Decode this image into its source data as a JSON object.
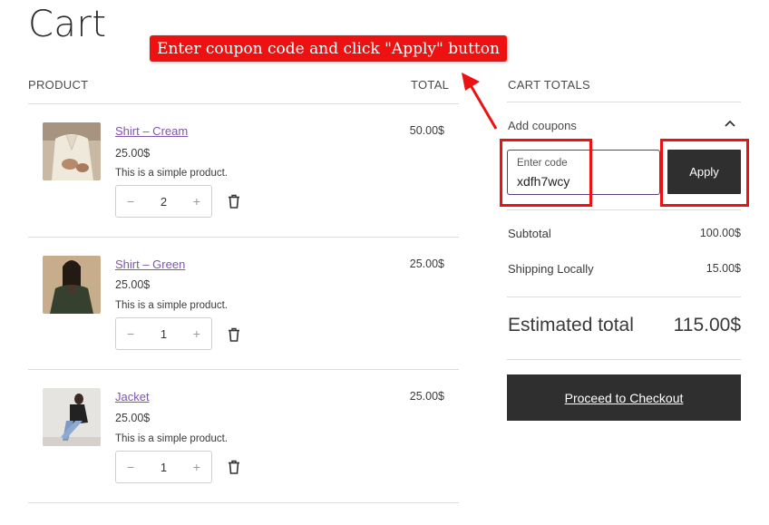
{
  "page": {
    "title": "Cart"
  },
  "callout": {
    "text": "Enter coupon code and click \"Apply\" button"
  },
  "table": {
    "product_header": "PRODUCT",
    "total_header": "TOTAL"
  },
  "items": [
    {
      "name": "Shirt – Cream",
      "price": "25.00$",
      "description": "This is a simple product.",
      "quantity": "2",
      "total": "50.00$"
    },
    {
      "name": "Shirt – Green",
      "price": "25.00$",
      "description": "This is a simple product.",
      "quantity": "1",
      "total": "25.00$"
    },
    {
      "name": "Jacket",
      "price": "25.00$",
      "description": "This is a simple product.",
      "quantity": "1",
      "total": "25.00$"
    }
  ],
  "qty_controls": {
    "minus": "−",
    "plus": "+"
  },
  "cart_totals": {
    "header": "CART TOTALS",
    "coupon_label": "Add coupons",
    "coupon_placeholder": "Enter code",
    "coupon_value": "xdfh7wcy",
    "apply_label": "Apply",
    "subtotal_label": "Subtotal",
    "subtotal_value": "100.00$",
    "shipping_label": "Shipping Locally",
    "shipping_value": "15.00$",
    "estimated_label": "Estimated total",
    "estimated_value": "115.00$",
    "checkout_label": "Proceed to Checkout"
  },
  "colors": {
    "accent_link": "#7f54b3",
    "button_dark": "#2f2f2f",
    "highlight_red": "#ee1111",
    "input_border": "#5b3e84"
  }
}
